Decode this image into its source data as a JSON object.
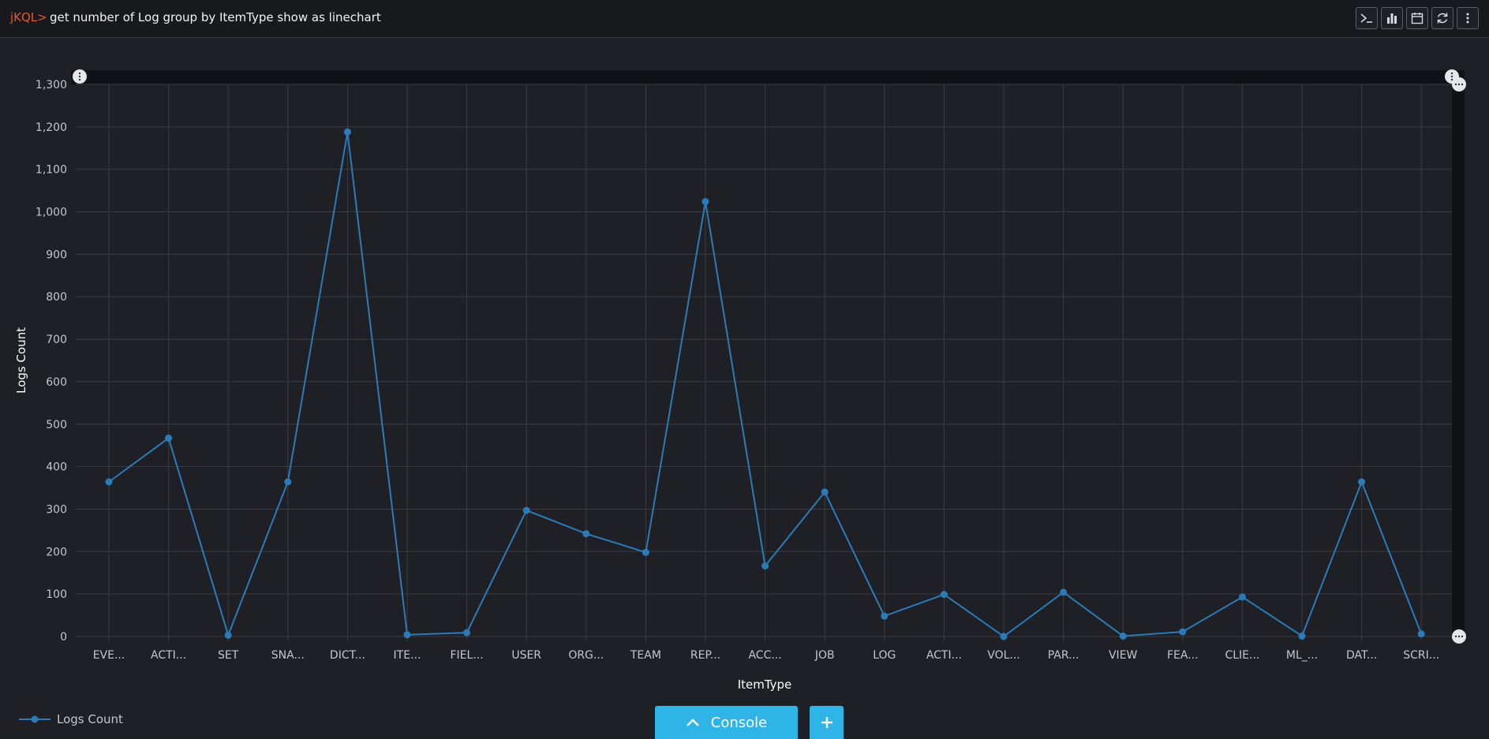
{
  "header": {
    "prompt": "jKQL>",
    "query": "get number of Log group by ItemType show as linechart",
    "toolbar": [
      "terminal-icon",
      "bar-chart-icon",
      "calendar-icon",
      "refresh-icon",
      "kebab-menu-icon"
    ]
  },
  "colors": {
    "background": "#1f2025",
    "series": "#2b7bb9",
    "grid": "#3a3c43",
    "accent_button": "#2fb4e8",
    "prompt": "#e8572f"
  },
  "footer": {
    "console_label": "Console",
    "plus_label": "+"
  },
  "chart_data": {
    "type": "line",
    "title": "",
    "xlabel": "ItemType",
    "ylabel": "Logs Count",
    "ylim": [
      0,
      1300
    ],
    "yticks": [
      0,
      100,
      200,
      300,
      400,
      500,
      600,
      700,
      800,
      900,
      1000,
      1100,
      1200,
      1300
    ],
    "ytick_labels": [
      "0",
      "100",
      "200",
      "300",
      "400",
      "500",
      "600",
      "700",
      "800",
      "900",
      "1,000",
      "1,100",
      "1,200",
      "1,300"
    ],
    "categories": [
      "EVE...",
      "ACTI...",
      "SET",
      "SNA...",
      "DICT...",
      "ITE...",
      "FIEL...",
      "USER",
      "ORG...",
      "TEAM",
      "REP...",
      "ACC...",
      "JOB",
      "LOG",
      "ACTI...",
      "VOL...",
      "PAR...",
      "VIEW",
      "FEA...",
      "CLIE...",
      "ML_...",
      "DAT...",
      "SCRI..."
    ],
    "grid": true,
    "legend_position": "bottom-left",
    "series": [
      {
        "name": "Logs Count",
        "values": [
          364,
          467,
          3,
          364,
          1188,
          4,
          9,
          297,
          242,
          198,
          1024,
          166,
          340,
          48,
          99,
          0,
          104,
          1,
          11,
          93,
          1,
          364,
          6
        ]
      }
    ]
  }
}
